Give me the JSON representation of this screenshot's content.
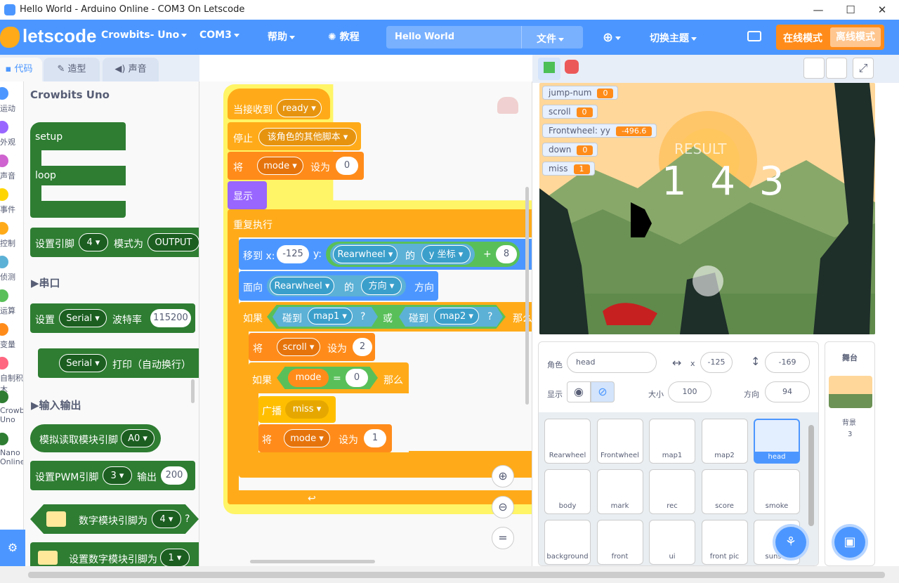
{
  "window": {
    "title": "Hello World - Arduino Online - COM3 On Letscode",
    "minimize": "—",
    "maximize": "☐",
    "close": "✕"
  },
  "menu": {
    "logo": "letscode",
    "board": "Crowbits- Uno",
    "port": "COM3",
    "help": "帮助",
    "tutorial": "教程",
    "project_name": "Hello World",
    "file": "文件",
    "theme": "切换主题",
    "online_mode": "在线模式",
    "offline_mode": "离线模式"
  },
  "tabs": {
    "code": "代码",
    "costume": "造型",
    "sound": "声音"
  },
  "categories": [
    {
      "label": "运动",
      "color": "#4c97ff"
    },
    {
      "label": "外观",
      "color": "#9966ff"
    },
    {
      "label": "声音",
      "color": "#cf63cf"
    },
    {
      "label": "事件",
      "color": "#ffd500"
    },
    {
      "label": "控制",
      "color": "#ffab19"
    },
    {
      "label": "侦测",
      "color": "#5cb1d6"
    },
    {
      "label": "运算",
      "color": "#59c059"
    },
    {
      "label": "变量",
      "color": "#ff8c1a"
    },
    {
      "label": "自制积木",
      "color": "#ff6680"
    },
    {
      "label": "Crowbits Uno",
      "color": "#2e7d32"
    },
    {
      "label": "Nano Online",
      "color": "#2e7d32"
    }
  ],
  "palette": {
    "heading": "Crowbits Uno",
    "setup": "setup",
    "loop": "loop",
    "set_pin": "设置引脚",
    "pin_val": "4",
    "mode_label": "模式为",
    "mode_val": "OUTPUT",
    "serial_heading": "▶串口",
    "serial_set": "设置",
    "serial_val": "Serial",
    "baud_label": "波特率",
    "baud_val": "115200",
    "serial_print_label": "打印（自动换行）",
    "io_heading": "▶输入输出",
    "analog_read": "模拟读取模块引脚",
    "analog_pin": "A0",
    "pwm_set": "设置PWM引脚",
    "pwm_pin": "3",
    "pwm_out": "输出",
    "pwm_val": "200",
    "digital_module": "数字模块引脚为",
    "digital_pin": "4",
    "digital_q": "?",
    "digital_set": "设置数字模块引脚为",
    "digital_set_pin": "1"
  },
  "script": {
    "when_receive": "当接收到",
    "ready": "ready",
    "stop": "停止",
    "stop_opt": "该角色的其他脚本",
    "set1": "将",
    "var_mode": "mode",
    "set_to": "设为",
    "zero": "0",
    "show": "显示",
    "forever": "重复执行",
    "goto": "移到 x:",
    "x_val": "-125",
    "y_lbl": "y:",
    "rearwheel": "Rearwheel",
    "of": "的",
    "y_coord": "y 坐标",
    "plus": "+",
    "eight": "8",
    "point": "面向",
    "direction": "方向",
    "direction2": "方向",
    "if": "如果",
    "touch": "碰到",
    "map1": "map1",
    "q": "?",
    "or": "或",
    "map2": "map2",
    "then": "那么",
    "scroll": "scroll",
    "two": "2",
    "eq": "=",
    "then2": "那么",
    "broadcast": "广播",
    "miss": "miss",
    "one": "1"
  },
  "stage_vars": [
    {
      "name": "jump-num",
      "value": "0"
    },
    {
      "name": "scroll",
      "value": "0"
    },
    {
      "name": "Frontwheel: yy",
      "value": "-496.6"
    },
    {
      "name": "down",
      "value": "0"
    },
    {
      "name": "miss",
      "value": "1"
    }
  ],
  "stage": {
    "result": "RESULT",
    "digits": "1 4 3"
  },
  "sprite_info": {
    "sprite_label": "角色",
    "sprite_name": "head",
    "x_label": "x",
    "x": "-125",
    "y_label": "y",
    "y": "-169",
    "show_label": "显示",
    "size_label": "大小",
    "size": "100",
    "dir_label": "方向",
    "dir": "94"
  },
  "sprites": [
    "Rearwheel",
    "Frontwheel",
    "map1",
    "map2",
    "head",
    "body",
    "mark",
    "rec",
    "score",
    "smoke",
    "background",
    "front",
    "ui",
    "front pic",
    "sunset"
  ],
  "stage_panel": {
    "title": "舞台",
    "backdrop_label": "背景",
    "backdrop_count": "3"
  }
}
